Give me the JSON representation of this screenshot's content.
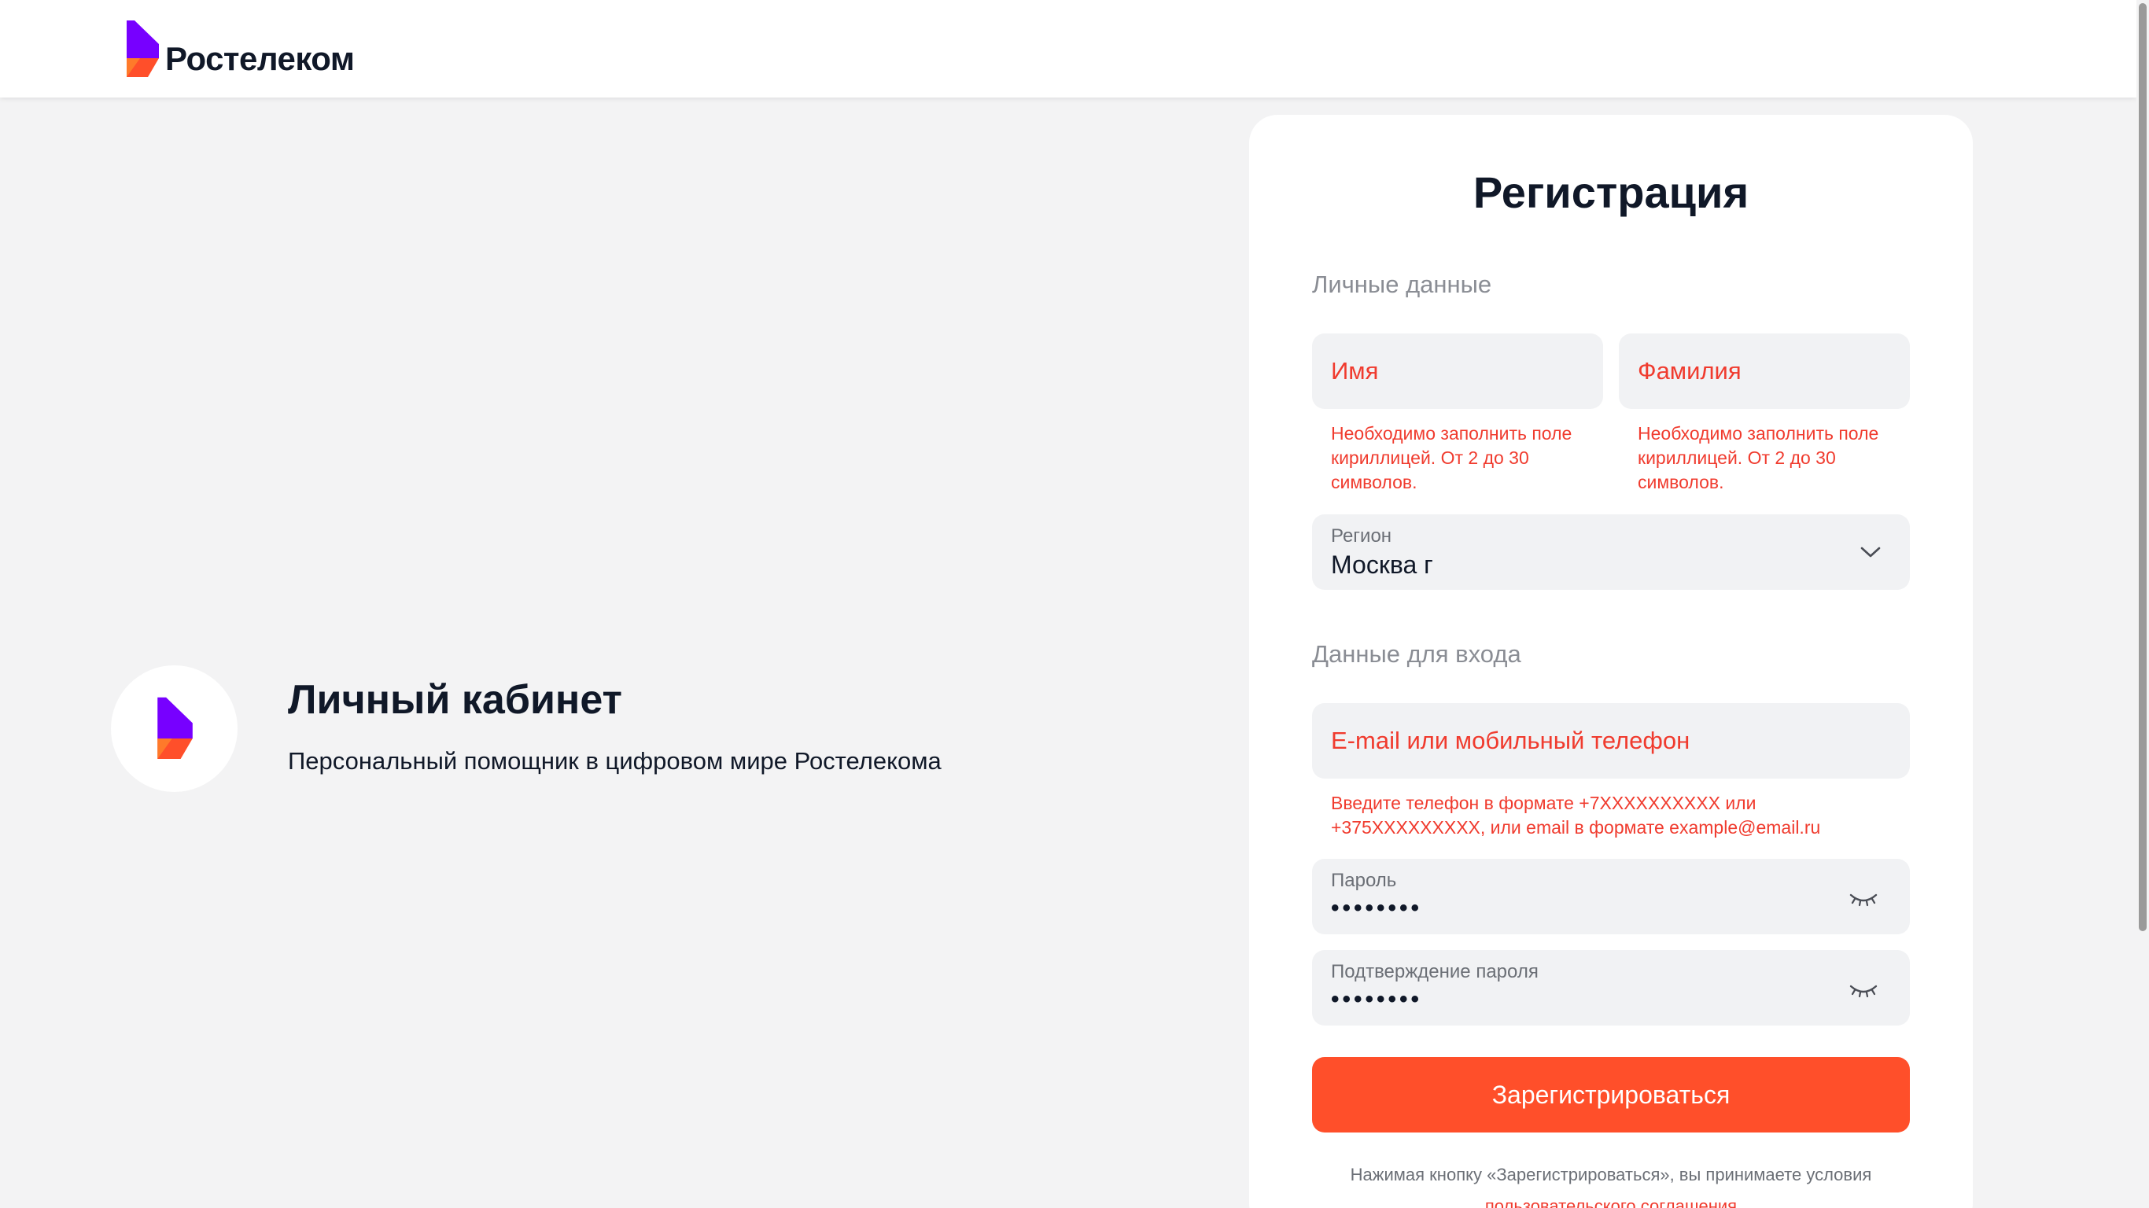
{
  "header": {
    "brand": "Ростелеком"
  },
  "promo": {
    "title": "Личный кабинет",
    "subtitle": "Персональный помощник в цифровом мире Ростелекома"
  },
  "registration": {
    "title": "Регистрация",
    "personal_section": "Личные данные",
    "first_name": {
      "placeholder": "Имя",
      "error": "Необходимо заполнить поле кириллицей. От 2 до 30 символов."
    },
    "last_name": {
      "placeholder": "Фамилия",
      "error": "Необходимо заполнить поле кириллицей. От 2 до 30 символов."
    },
    "region": {
      "label": "Регион",
      "value": "Москва г"
    },
    "login_section": "Данные для входа",
    "login": {
      "placeholder": "E-mail или мобильный телефон",
      "error": "Введите телефон в формате +7XXXXXXXXXX или +375XXXXXXXXX, или email в формате example@email.ru"
    },
    "password": {
      "label": "Пароль",
      "value": "••••••••"
    },
    "password_confirm": {
      "label": "Подтверждение пароля",
      "value": "••••••••"
    },
    "submit_label": "Зарегистрироваться",
    "legal_text": "Нажимая кнопку «Зарегистрироваться», вы принимаете условия",
    "legal_link": "пользовательского соглашения"
  },
  "colors": {
    "accent": "#ff4f2a",
    "error": "#f03b2e",
    "brand_purple": "#7700ff",
    "background": "#f3f3f4"
  },
  "icons": {
    "region_dropdown": "chevron-down-icon",
    "password_toggle": "eye-closed-icon"
  }
}
